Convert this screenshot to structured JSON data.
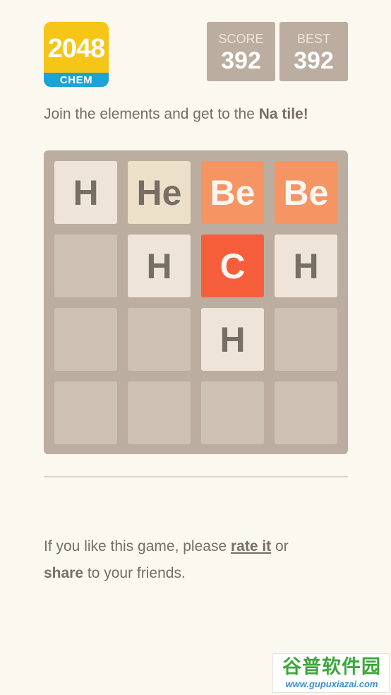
{
  "logo": {
    "number": "2048",
    "subtitle": "CHEM"
  },
  "score": {
    "label": "SCORE",
    "value": "392"
  },
  "best": {
    "label": "BEST",
    "value": "392"
  },
  "intro": {
    "text": "Join the elements and get to the ",
    "goal": "Na tile!"
  },
  "board": {
    "rows": [
      [
        "H",
        "He",
        "Be",
        "Be"
      ],
      [
        "",
        "H",
        "C",
        "H"
      ],
      [
        "",
        "",
        "H",
        ""
      ],
      [
        "",
        "",
        "",
        ""
      ]
    ]
  },
  "footer": {
    "part1": "If you like this game, please ",
    "rate_link": "rate it",
    "part2": " or",
    "share_link": "share",
    "part3": " to your friends."
  },
  "watermark": {
    "title": "谷普软件园",
    "url": "www.gupuxiazai.com"
  },
  "colors": {
    "background": "#faf8ef",
    "board": "#bbada0",
    "empty_cell": "#cdc1b4",
    "H": "#eee4da",
    "He": "#ede0c8",
    "Be": "#f59563",
    "C": "#f65e3b",
    "text": "#776e65"
  }
}
